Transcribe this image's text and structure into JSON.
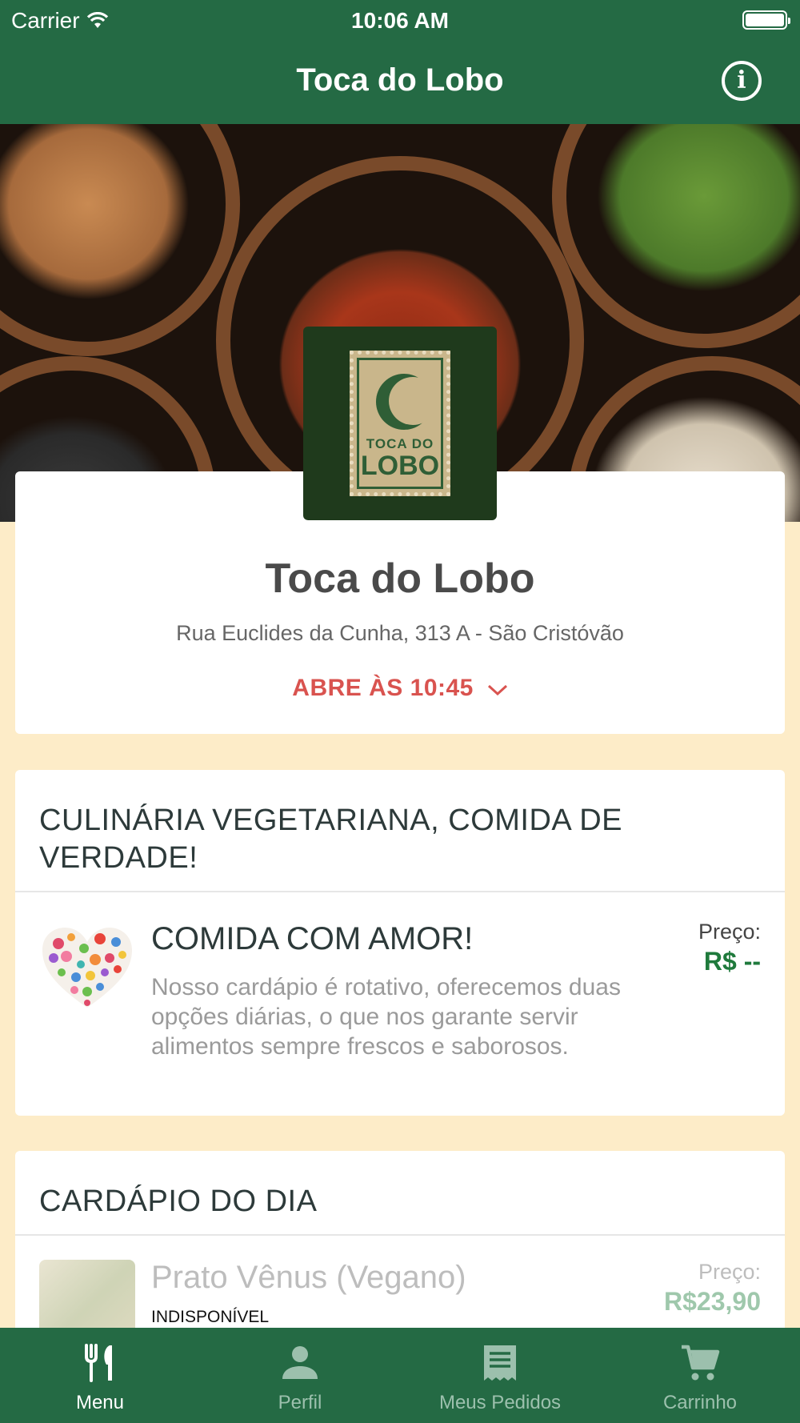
{
  "status_bar": {
    "carrier": "Carrier",
    "time": "10:06 AM"
  },
  "nav": {
    "title": "Toca do Lobo",
    "info_icon": "info-icon"
  },
  "logo": {
    "line1": "TOCA DO",
    "line2": "LOBO"
  },
  "store": {
    "name": "Toca do Lobo",
    "address": "Rua Euclides da Cunha, 313 A - São Cristóvão",
    "hours": "ABRE ÀS 10:45"
  },
  "sections": [
    {
      "title": "CULINÁRIA VEGETARIANA, COMIDA DE VERDADE!",
      "items": [
        {
          "name": "COMIDA COM AMOR!",
          "description": "Nosso cardápio é rotativo, oferecemos duas opções diárias, o que nos garante servir alimentos sempre frescos e saborosos.",
          "price_label": "Preço:",
          "price": "R$ --"
        }
      ]
    },
    {
      "title": "CARDÁPIO DO DIA",
      "items": [
        {
          "name": "Prato Vênus (Vegano)",
          "status": "INDISPONÍVEL",
          "price_label": "Preço:",
          "price": "R$23,90"
        }
      ]
    }
  ],
  "tabbar": [
    {
      "label": "Menu",
      "icon": "fork-knife-icon",
      "active": true
    },
    {
      "label": "Perfil",
      "icon": "person-icon",
      "active": false
    },
    {
      "label": "Meus Pedidos",
      "icon": "receipt-icon",
      "active": false
    },
    {
      "label": "Carrinho",
      "icon": "cart-icon",
      "active": false
    }
  ],
  "colors": {
    "primary": "#246a44",
    "background": "#fdecc8",
    "hours_red": "#d9534f",
    "price_green": "#1f7a3c"
  }
}
